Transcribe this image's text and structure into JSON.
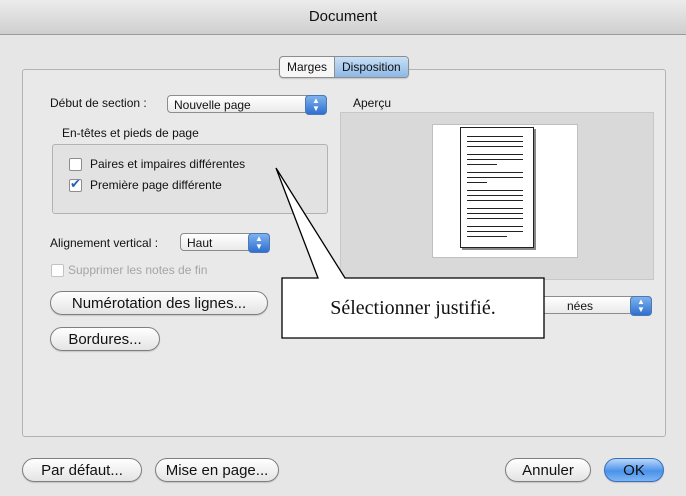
{
  "window": {
    "title": "Document"
  },
  "tabs": [
    {
      "label": "Marges",
      "active": false
    },
    {
      "label": "Disposition",
      "active": true
    }
  ],
  "section_start": {
    "label": "Début de section :",
    "value": "Nouvelle page"
  },
  "headers_group": {
    "title": "En-têtes et pieds de page",
    "odd_even": {
      "label": "Paires et impaires différentes",
      "checked": false
    },
    "first_page": {
      "label": "Première page différente",
      "checked": true
    }
  },
  "vertical_alignment": {
    "label": "Alignement vertical :",
    "value": "Haut"
  },
  "suppress_endnotes": {
    "label": "Supprimer les notes de fin",
    "checked": false,
    "enabled": false
  },
  "line_numbering_button": "Numérotation des lignes...",
  "borders_button": "Bordures...",
  "preview": {
    "label": "Aperçu"
  },
  "apply_to": {
    "visible_value": "nées"
  },
  "callout": {
    "text": "Sélectionner justifié."
  },
  "footer": {
    "default_button": "Par défaut...",
    "page_setup_button": "Mise en page...",
    "cancel_button": "Annuler",
    "ok_button": "OK"
  },
  "colors": {
    "accent": "#4b92ea",
    "window_bg": "#e6e6e6"
  }
}
